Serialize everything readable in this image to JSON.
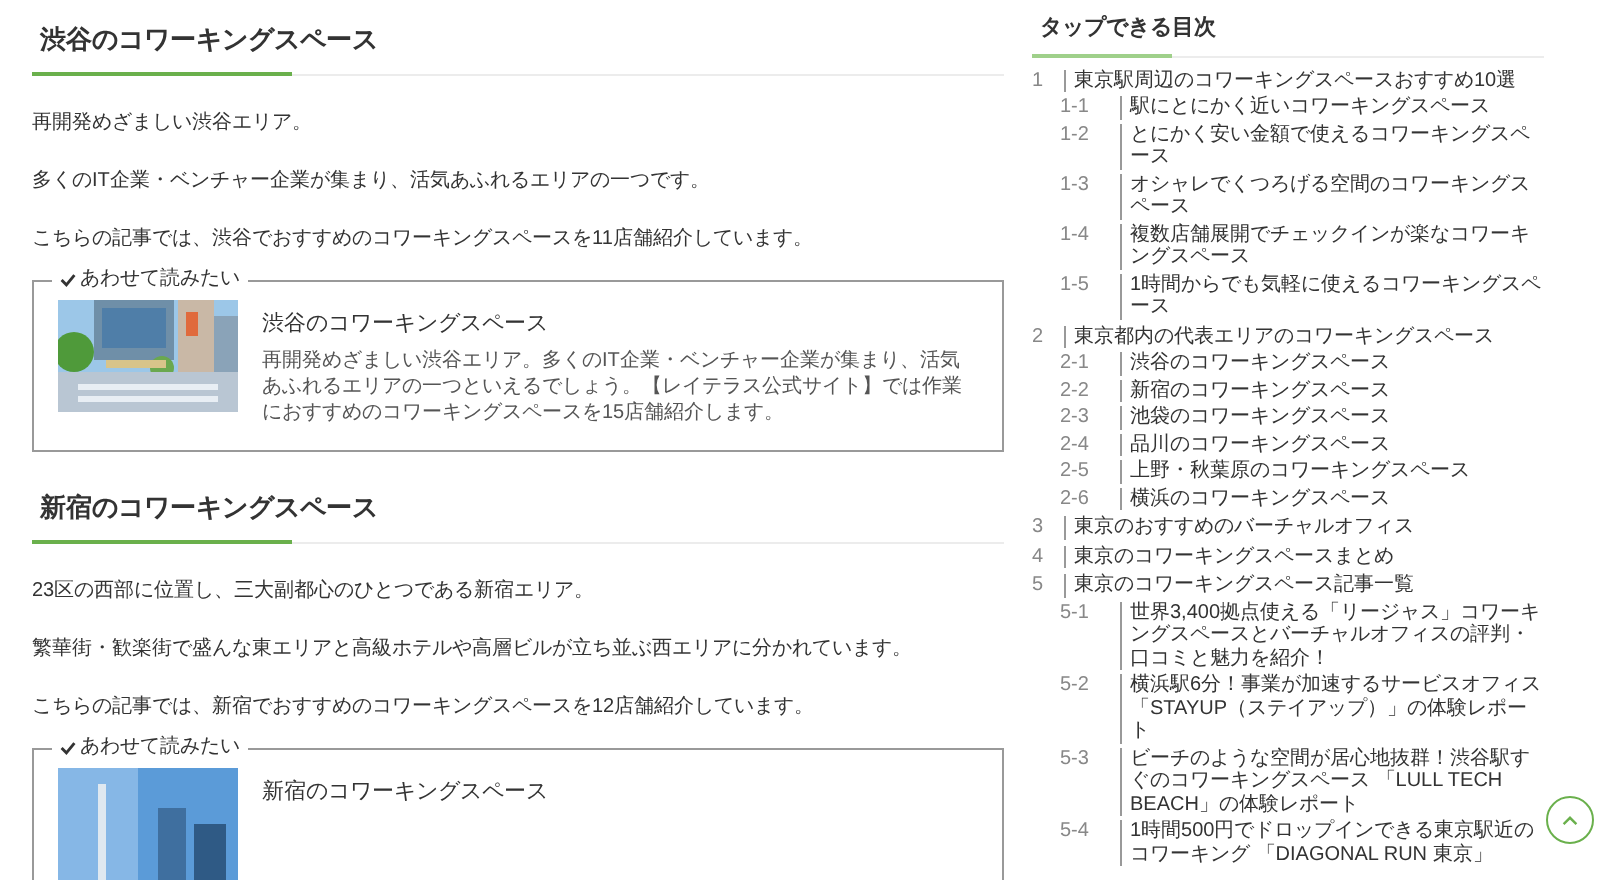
{
  "sections": [
    {
      "heading": "渋谷のコワーキングスペース",
      "paragraphs": [
        "再開発めざましい渋谷エリア。",
        "多くのIT企業・ベンチャー企業が集まり、活気あふれるエリアの一つです。",
        "こちらの記事では、渋谷でおすすめのコワーキングスペースを11店舗紹介しています。"
      ],
      "related": {
        "label": "あわせて読みたい",
        "title": "渋谷のコワーキングスペース",
        "description": "再開発めざましい渋谷エリア。多くのIT企業・ベンチャー企業が集まり、活気あふれるエリアの一つといえるでしょう。【レイテラス公式サイト】では作業におすすめのコワーキングスペースを15店舗紹介します。"
      }
    },
    {
      "heading": "新宿のコワーキングスペース",
      "paragraphs": [
        "23区の西部に位置し、三大副都心のひとつである新宿エリア。",
        "繁華街・歓楽街で盛んな東エリアと高級ホテルや高層ビルが立ち並ぶ西エリアに分かれています。",
        "こちらの記事では、新宿でおすすめのコワーキングスペースを12店舗紹介しています。"
      ],
      "related": {
        "label": "あわせて読みたい",
        "title": "新宿のコワーキングスペース"
      }
    }
  ],
  "toc": {
    "title": "タップできる目次",
    "items": [
      {
        "number": "1",
        "text": "東京駅周辺のコワーキングスペースおすすめ10選",
        "children": [
          {
            "number": "1-1",
            "text": "駅にとにかく近いコワーキングスペース"
          },
          {
            "number": "1-2",
            "text": "とにかく安い金額で使えるコワーキングスペース"
          },
          {
            "number": "1-3",
            "text": "オシャレでくつろげる空間のコワーキングスペース"
          },
          {
            "number": "1-4",
            "text": "複数店舗展開でチェックインが楽なコワーキングスペース"
          },
          {
            "number": "1-5",
            "text": "1時間からでも気軽に使えるコワーキングスペース"
          }
        ]
      },
      {
        "number": "2",
        "text": "東京都内の代表エリアのコワーキングスペース",
        "children": [
          {
            "number": "2-1",
            "text": "渋谷のコワーキングスペース"
          },
          {
            "number": "2-2",
            "text": "新宿のコワーキングスペース"
          },
          {
            "number": "2-3",
            "text": "池袋のコワーキングスペース"
          },
          {
            "number": "2-4",
            "text": "品川のコワーキングスペース"
          },
          {
            "number": "2-5",
            "text": "上野・秋葉原のコワーキングスペース"
          },
          {
            "number": "2-6",
            "text": "横浜のコワーキングスペース"
          }
        ]
      },
      {
        "number": "3",
        "text": "東京のおすすめのバーチャルオフィス"
      },
      {
        "number": "4",
        "text": "東京のコワーキングスペースまとめ"
      },
      {
        "number": "5",
        "text": "東京のコワーキングスペース記事一覧",
        "children": [
          {
            "number": "5-1",
            "text": "世界3,400拠点使える「リージャス」コワーキングスペースとバーチャルオフィスの評判・口コミと魅力を紹介！"
          },
          {
            "number": "5-2",
            "text": "横浜駅6分！事業が加速するサービスオフィス「STAYUP（ステイアップ）」の体験レポート"
          },
          {
            "number": "5-3",
            "text": "ビーチのような空間が居心地抜群！渋谷駅すぐのコワーキングスペース 「LULL TECH BEACH」の体験レポート"
          },
          {
            "number": "5-4",
            "text": "1時間500円でドロップインできる東京駅近のコワーキング 「DIAGONAL RUN 東京」"
          }
        ]
      }
    ]
  }
}
